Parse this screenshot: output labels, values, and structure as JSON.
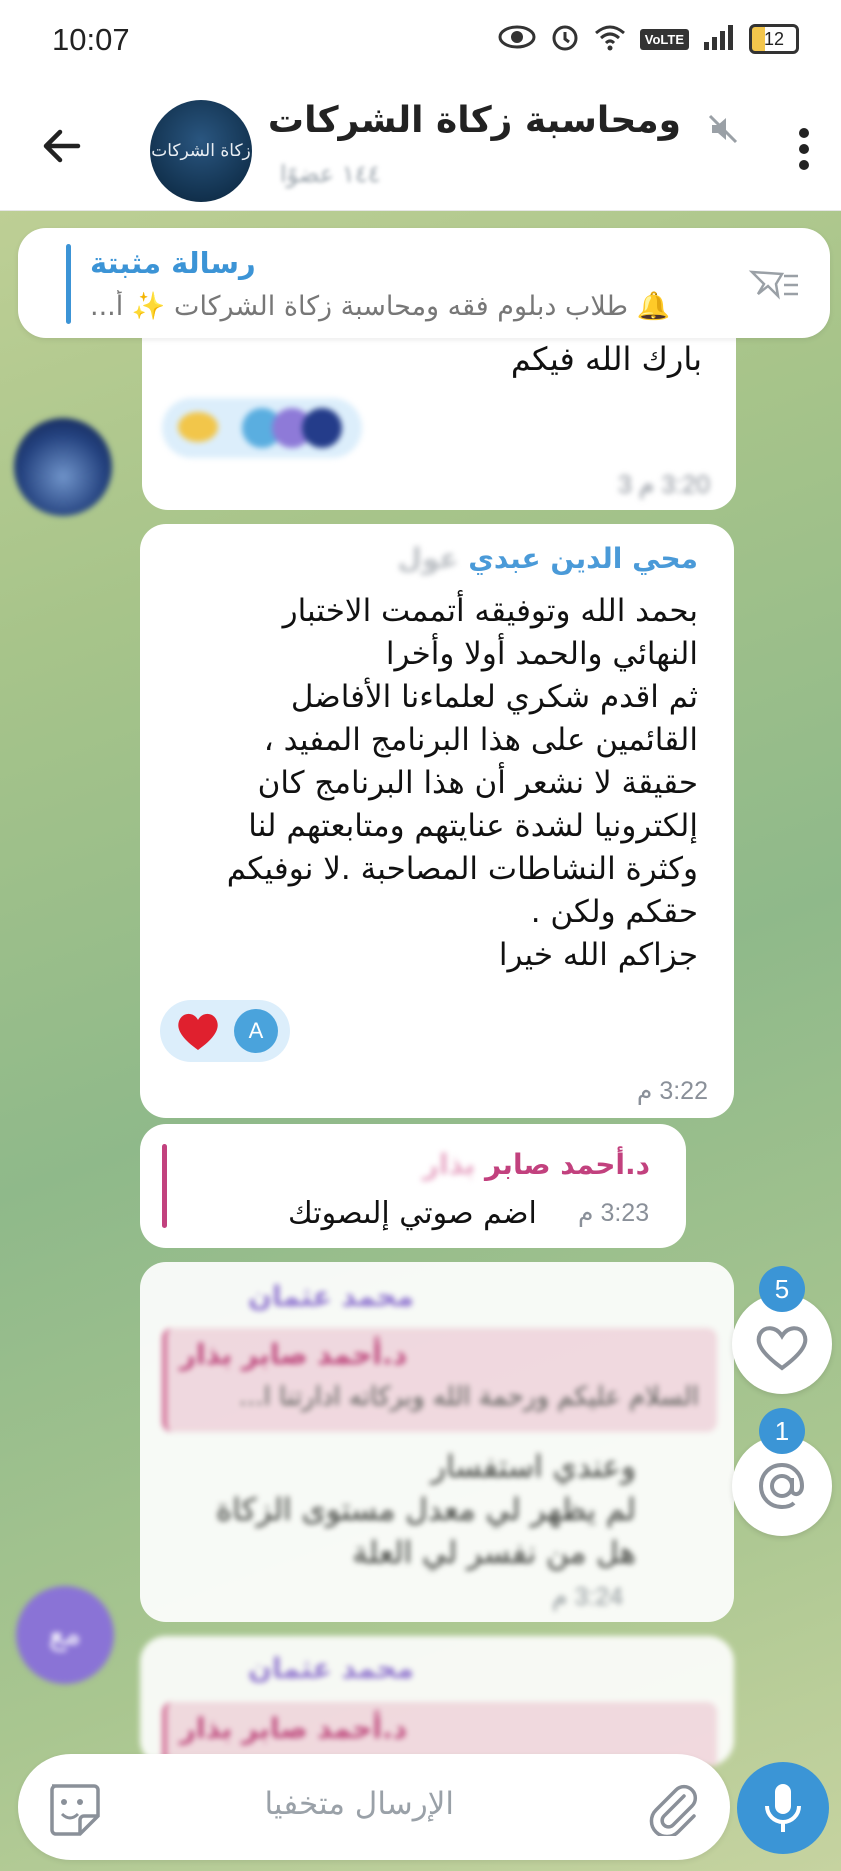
{
  "status_bar": {
    "time": "10:07",
    "network": "VoLTE",
    "battery": "12"
  },
  "header": {
    "title": "ومحاسبة زكاة الشركات",
    "subtitle": "١٤٤ عضوًا",
    "avatar_text": "زكاة الشركات"
  },
  "pinned": {
    "title": "رسالة مثبتة",
    "text": "🔔 طلاب دبلوم فقه ومحاسبة زكاة الشركات ✨ أ..."
  },
  "messages": {
    "m1": {
      "text": "بارك الله فيكم",
      "time": "3:20 م 3"
    },
    "m2": {
      "sender": "محي الدين عبدي",
      "sender_suffix": "عول",
      "lines": [
        "بحمد الله وتوفيقه أتممت الاختبار",
        "النهائي والحمد أولا وأخرا",
        "ثم اقدم شكري لعلماءنا الأفاضل",
        "القائمين على هذا البرنامج المفيد ،",
        "حقيقة لا نشعر أن هذا البرنامج كان",
        "إلكترونيا  لشدة عنايتهم ومتابعتهم لنا",
        "وكثرة النشاطات  المصاحبة .لا نوفيكم",
        "حقكم ولكن .",
        "جزاكم الله خيرا"
      ],
      "reaction_user": "A",
      "time": "3:22 م"
    },
    "m3": {
      "sender": "د.أحمد صابر",
      "sender_suffix": "بذار",
      "text": "اضم صوتي إلىصوتك",
      "time": "3:23 م"
    },
    "m4": {
      "sender": "محمد عثمان",
      "reply_sender": "د.أحمد صابر بذار",
      "reply_text": "السلام عليكم ورحمة الله وبركاته ادارتنا ا...",
      "lines": [
        "وعندي استفسار",
        "لم يظهر لي معدل مستوى الزكاة",
        "هل من نفسر لي العلة"
      ],
      "time": "3:24 م"
    },
    "m5": {
      "sender": "محمد عثمان",
      "reply_sender": "د.أحمد صابر بذار"
    }
  },
  "avatar_initials": "مع",
  "floating": {
    "reactions_count": "5",
    "mentions_count": "1"
  },
  "input": {
    "placeholder": "الإرسال متخفيا"
  },
  "colors": {
    "accent": "#3b95d6",
    "sender_blue": "#4a9ad8",
    "sender_pink": "#c2417e",
    "sender_purple": "#8f6fd6"
  }
}
